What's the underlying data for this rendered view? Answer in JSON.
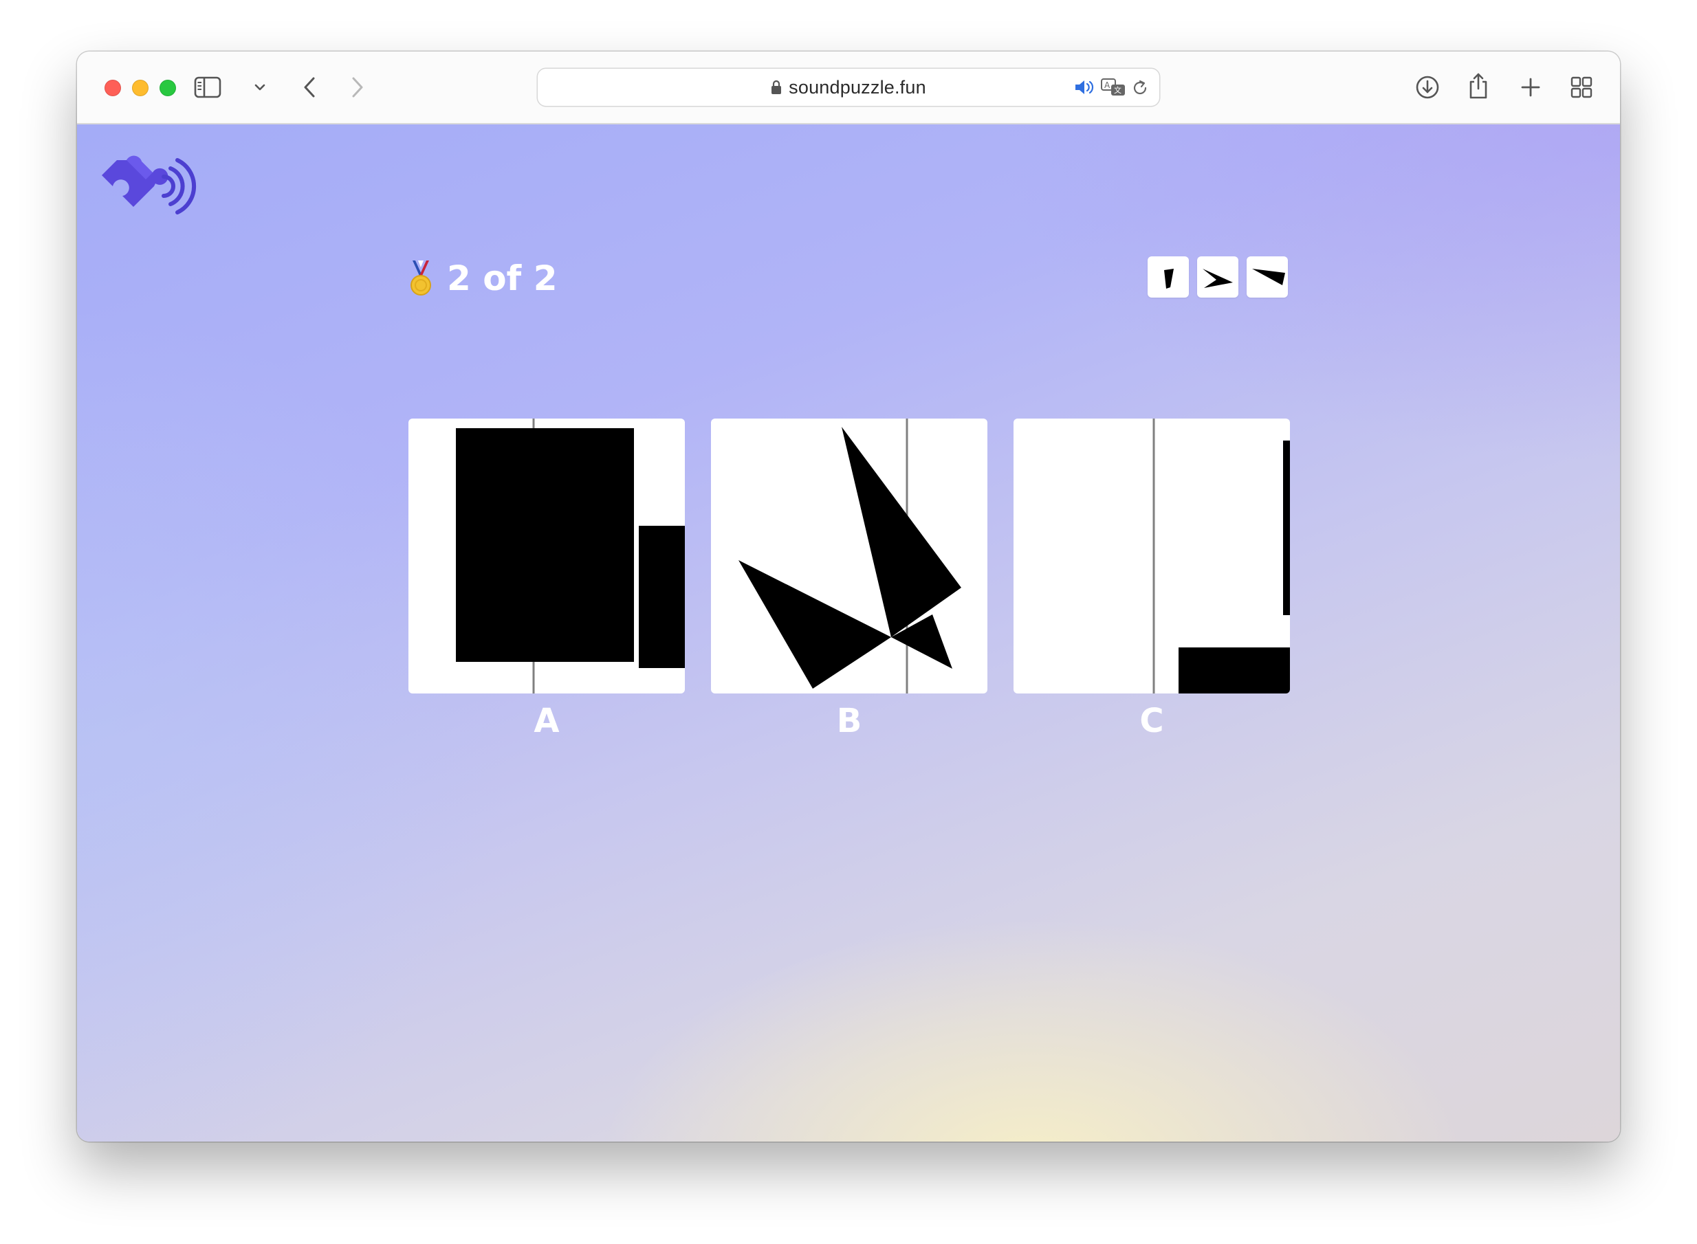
{
  "browser": {
    "url": "soundpuzzle.fun",
    "icons": [
      "sidebar-icon",
      "chevron-down-icon",
      "back-icon",
      "forward-icon",
      "lock-icon",
      "speaker-icon",
      "translate-icon",
      "reload-icon",
      "download-icon",
      "share-icon",
      "plus-icon",
      "tabs-grid-icon"
    ]
  },
  "app": {
    "logo_icon": "puzzle-sound-logo-icon",
    "progress": {
      "medal_icon": "medal-icon",
      "text": "2 of 2"
    },
    "pieces_icons": [
      "piece-shape-1",
      "piece-shape-2",
      "piece-shape-3"
    ],
    "options": [
      {
        "label": "A"
      },
      {
        "label": "B"
      },
      {
        "label": "C"
      }
    ]
  },
  "colors": {
    "logo": "#5b4de0",
    "card_bg": "#ffffff",
    "shape": "#000000",
    "divider_line": "#808080"
  }
}
